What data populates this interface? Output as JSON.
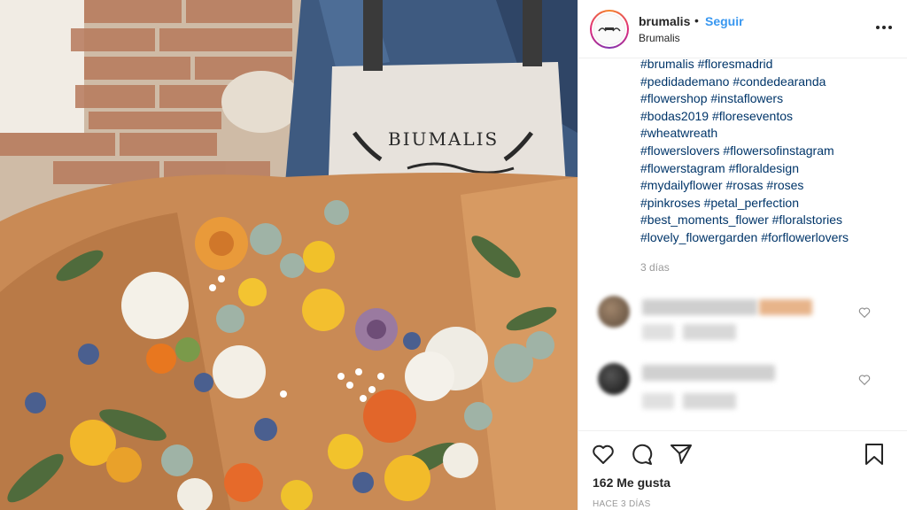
{
  "post": {
    "apron_text": "BIUMALIS"
  },
  "header": {
    "username": "brumalis",
    "separator": "•",
    "follow_label": "Seguir",
    "location": "Brumalis"
  },
  "caption": {
    "lines": [
      [
        "#brumalis",
        "#floresmadrid"
      ],
      [
        "#pedidademano",
        "#condedearanda"
      ],
      [
        "#flowershop",
        "#instaflowers"
      ],
      [
        "#bodas2019",
        "#floreseventos"
      ],
      [
        "#wheatwreath"
      ],
      [
        "#flowerslovers",
        "#flowersofinstagram"
      ],
      [
        "#flowerstagram",
        "#floraldesign"
      ],
      [
        "#mydailyflower",
        "#rosas",
        "#roses"
      ],
      [
        "#pinkroses",
        "#petal_perfection"
      ],
      [
        "#best_moments_flower",
        "#floralstories"
      ],
      [
        "#lovely_flowergarden",
        "#forflowerlovers"
      ]
    ],
    "time": "3 días"
  },
  "actions": {
    "likes": "162 Me gusta",
    "timestamp": "HACE 3 DÍAS"
  },
  "icons": {
    "like": "heart-icon",
    "comment": "comment-icon",
    "share": "share-icon",
    "save": "bookmark-icon",
    "more": "more-options-icon"
  },
  "colors": {
    "link": "#3897f0",
    "hashtag": "#003569",
    "muted": "#999999"
  }
}
